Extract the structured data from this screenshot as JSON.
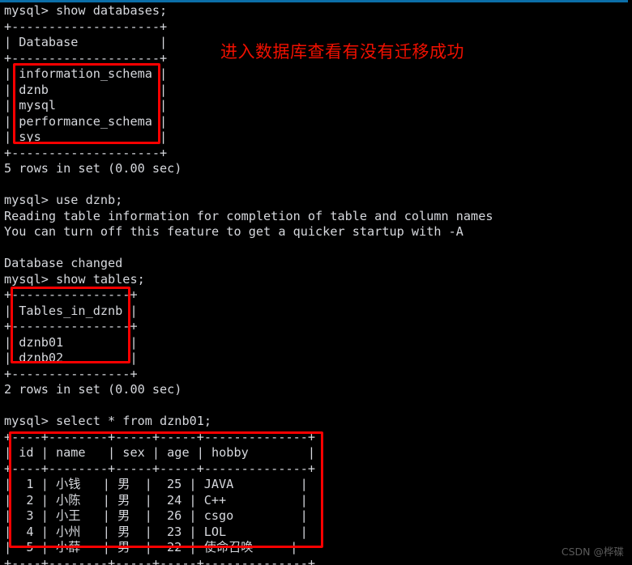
{
  "window": {
    "title": "mysql terminal",
    "top_accent_color": "#0b6ea8",
    "background_color": "#000000",
    "text_color": "#d6d8dd",
    "annotation_color": "#fb0000"
  },
  "terminal": {
    "lines": [
      "mysql> show databases;",
      "+--------------------+",
      "| Database           |",
      "+--------------------+",
      "| information_schema |",
      "| dznb               |",
      "| mysql              |",
      "| performance_schema |",
      "| sys                |",
      "+--------------------+",
      "5 rows in set (0.00 sec)",
      "",
      "mysql> use dznb;",
      "Reading table information for completion of table and column names",
      "You can turn off this feature to get a quicker startup with -A",
      "",
      "Database changed",
      "mysql> show tables;",
      "+----------------+",
      "| Tables_in_dznb |",
      "+----------------+",
      "| dznb01         |",
      "| dznb02         |",
      "+----------------+",
      "2 rows in set (0.00 sec)",
      "",
      "mysql> select * from dznb01;",
      "+----+--------+-----+-----+--------------+",
      "| id | name   | sex | age | hobby        |",
      "+----+--------+-----+-----+--------------+",
      "|  1 | 小钱   | 男  |  25 | JAVA         |",
      "|  2 | 小陈   | 男  |  24 | C++          |",
      "|  3 | 小王   | 男  |  26 | csgo         |",
      "|  4 | 小州   | 男  |  23 | LOL          |",
      "|  5 | 小薛   | 男  |  22 | 使命召唤     |",
      "+----+--------+-----+-----+--------------+"
    ]
  },
  "commands": [
    {
      "prompt": "mysql>",
      "text": "show databases;"
    },
    {
      "prompt": "mysql>",
      "text": "use dznb;"
    },
    {
      "prompt": "mysql>",
      "text": "show tables;"
    },
    {
      "prompt": "mysql>",
      "text": "select * from dznb01;"
    }
  ],
  "results": {
    "databases": {
      "columns": [
        "Database"
      ],
      "rows": [
        [
          "information_schema"
        ],
        [
          "dznb"
        ],
        [
          "mysql"
        ],
        [
          "performance_schema"
        ],
        [
          "sys"
        ]
      ],
      "status": "5 rows in set (0.00 sec)"
    },
    "tables": {
      "columns": [
        "Tables_in_dznb"
      ],
      "rows": [
        [
          "dznb01"
        ],
        [
          "dznb02"
        ]
      ],
      "status": "2 rows in set (0.00 sec)"
    },
    "dznb01": {
      "columns": [
        "id",
        "name",
        "sex",
        "age",
        "hobby"
      ],
      "rows": [
        [
          "1",
          "小钱",
          "男",
          "25",
          "JAVA"
        ],
        [
          "2",
          "小陈",
          "男",
          "24",
          "C++"
        ],
        [
          "3",
          "小王",
          "男",
          "26",
          "csgo"
        ],
        [
          "4",
          "小州",
          "男",
          "23",
          "LOL"
        ],
        [
          "5",
          "小薛",
          "男",
          "22",
          "使命召唤"
        ]
      ]
    }
  },
  "messages": {
    "reading_table_info": "Reading table information for completion of table and column names",
    "turn_off_hint": "You can turn off this feature to get a quicker startup with -A",
    "database_changed": "Database changed"
  },
  "annotation": {
    "text": "进入数据库查看有没有迁移成功"
  },
  "watermark": {
    "text": "CSDN @桦碟"
  }
}
